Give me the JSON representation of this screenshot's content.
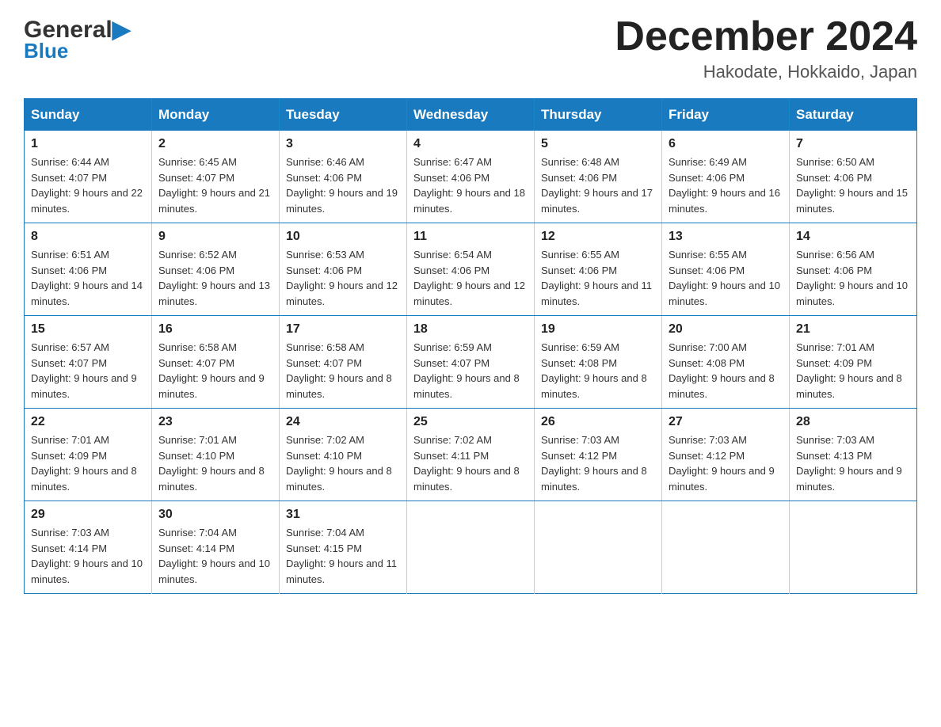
{
  "header": {
    "logo_general": "General",
    "logo_blue": "Blue",
    "month_title": "December 2024",
    "location": "Hakodate, Hokkaido, Japan"
  },
  "days_of_week": [
    "Sunday",
    "Monday",
    "Tuesday",
    "Wednesday",
    "Thursday",
    "Friday",
    "Saturday"
  ],
  "weeks": [
    [
      {
        "day": "1",
        "sunrise": "Sunrise: 6:44 AM",
        "sunset": "Sunset: 4:07 PM",
        "daylight": "Daylight: 9 hours and 22 minutes."
      },
      {
        "day": "2",
        "sunrise": "Sunrise: 6:45 AM",
        "sunset": "Sunset: 4:07 PM",
        "daylight": "Daylight: 9 hours and 21 minutes."
      },
      {
        "day": "3",
        "sunrise": "Sunrise: 6:46 AM",
        "sunset": "Sunset: 4:06 PM",
        "daylight": "Daylight: 9 hours and 19 minutes."
      },
      {
        "day": "4",
        "sunrise": "Sunrise: 6:47 AM",
        "sunset": "Sunset: 4:06 PM",
        "daylight": "Daylight: 9 hours and 18 minutes."
      },
      {
        "day": "5",
        "sunrise": "Sunrise: 6:48 AM",
        "sunset": "Sunset: 4:06 PM",
        "daylight": "Daylight: 9 hours and 17 minutes."
      },
      {
        "day": "6",
        "sunrise": "Sunrise: 6:49 AM",
        "sunset": "Sunset: 4:06 PM",
        "daylight": "Daylight: 9 hours and 16 minutes."
      },
      {
        "day": "7",
        "sunrise": "Sunrise: 6:50 AM",
        "sunset": "Sunset: 4:06 PM",
        "daylight": "Daylight: 9 hours and 15 minutes."
      }
    ],
    [
      {
        "day": "8",
        "sunrise": "Sunrise: 6:51 AM",
        "sunset": "Sunset: 4:06 PM",
        "daylight": "Daylight: 9 hours and 14 minutes."
      },
      {
        "day": "9",
        "sunrise": "Sunrise: 6:52 AM",
        "sunset": "Sunset: 4:06 PM",
        "daylight": "Daylight: 9 hours and 13 minutes."
      },
      {
        "day": "10",
        "sunrise": "Sunrise: 6:53 AM",
        "sunset": "Sunset: 4:06 PM",
        "daylight": "Daylight: 9 hours and 12 minutes."
      },
      {
        "day": "11",
        "sunrise": "Sunrise: 6:54 AM",
        "sunset": "Sunset: 4:06 PM",
        "daylight": "Daylight: 9 hours and 12 minutes."
      },
      {
        "day": "12",
        "sunrise": "Sunrise: 6:55 AM",
        "sunset": "Sunset: 4:06 PM",
        "daylight": "Daylight: 9 hours and 11 minutes."
      },
      {
        "day": "13",
        "sunrise": "Sunrise: 6:55 AM",
        "sunset": "Sunset: 4:06 PM",
        "daylight": "Daylight: 9 hours and 10 minutes."
      },
      {
        "day": "14",
        "sunrise": "Sunrise: 6:56 AM",
        "sunset": "Sunset: 4:06 PM",
        "daylight": "Daylight: 9 hours and 10 minutes."
      }
    ],
    [
      {
        "day": "15",
        "sunrise": "Sunrise: 6:57 AM",
        "sunset": "Sunset: 4:07 PM",
        "daylight": "Daylight: 9 hours and 9 minutes."
      },
      {
        "day": "16",
        "sunrise": "Sunrise: 6:58 AM",
        "sunset": "Sunset: 4:07 PM",
        "daylight": "Daylight: 9 hours and 9 minutes."
      },
      {
        "day": "17",
        "sunrise": "Sunrise: 6:58 AM",
        "sunset": "Sunset: 4:07 PM",
        "daylight": "Daylight: 9 hours and 8 minutes."
      },
      {
        "day": "18",
        "sunrise": "Sunrise: 6:59 AM",
        "sunset": "Sunset: 4:07 PM",
        "daylight": "Daylight: 9 hours and 8 minutes."
      },
      {
        "day": "19",
        "sunrise": "Sunrise: 6:59 AM",
        "sunset": "Sunset: 4:08 PM",
        "daylight": "Daylight: 9 hours and 8 minutes."
      },
      {
        "day": "20",
        "sunrise": "Sunrise: 7:00 AM",
        "sunset": "Sunset: 4:08 PM",
        "daylight": "Daylight: 9 hours and 8 minutes."
      },
      {
        "day": "21",
        "sunrise": "Sunrise: 7:01 AM",
        "sunset": "Sunset: 4:09 PM",
        "daylight": "Daylight: 9 hours and 8 minutes."
      }
    ],
    [
      {
        "day": "22",
        "sunrise": "Sunrise: 7:01 AM",
        "sunset": "Sunset: 4:09 PM",
        "daylight": "Daylight: 9 hours and 8 minutes."
      },
      {
        "day": "23",
        "sunrise": "Sunrise: 7:01 AM",
        "sunset": "Sunset: 4:10 PM",
        "daylight": "Daylight: 9 hours and 8 minutes."
      },
      {
        "day": "24",
        "sunrise": "Sunrise: 7:02 AM",
        "sunset": "Sunset: 4:10 PM",
        "daylight": "Daylight: 9 hours and 8 minutes."
      },
      {
        "day": "25",
        "sunrise": "Sunrise: 7:02 AM",
        "sunset": "Sunset: 4:11 PM",
        "daylight": "Daylight: 9 hours and 8 minutes."
      },
      {
        "day": "26",
        "sunrise": "Sunrise: 7:03 AM",
        "sunset": "Sunset: 4:12 PM",
        "daylight": "Daylight: 9 hours and 8 minutes."
      },
      {
        "day": "27",
        "sunrise": "Sunrise: 7:03 AM",
        "sunset": "Sunset: 4:12 PM",
        "daylight": "Daylight: 9 hours and 9 minutes."
      },
      {
        "day": "28",
        "sunrise": "Sunrise: 7:03 AM",
        "sunset": "Sunset: 4:13 PM",
        "daylight": "Daylight: 9 hours and 9 minutes."
      }
    ],
    [
      {
        "day": "29",
        "sunrise": "Sunrise: 7:03 AM",
        "sunset": "Sunset: 4:14 PM",
        "daylight": "Daylight: 9 hours and 10 minutes."
      },
      {
        "day": "30",
        "sunrise": "Sunrise: 7:04 AM",
        "sunset": "Sunset: 4:14 PM",
        "daylight": "Daylight: 9 hours and 10 minutes."
      },
      {
        "day": "31",
        "sunrise": "Sunrise: 7:04 AM",
        "sunset": "Sunset: 4:15 PM",
        "daylight": "Daylight: 9 hours and 11 minutes."
      },
      null,
      null,
      null,
      null
    ]
  ]
}
